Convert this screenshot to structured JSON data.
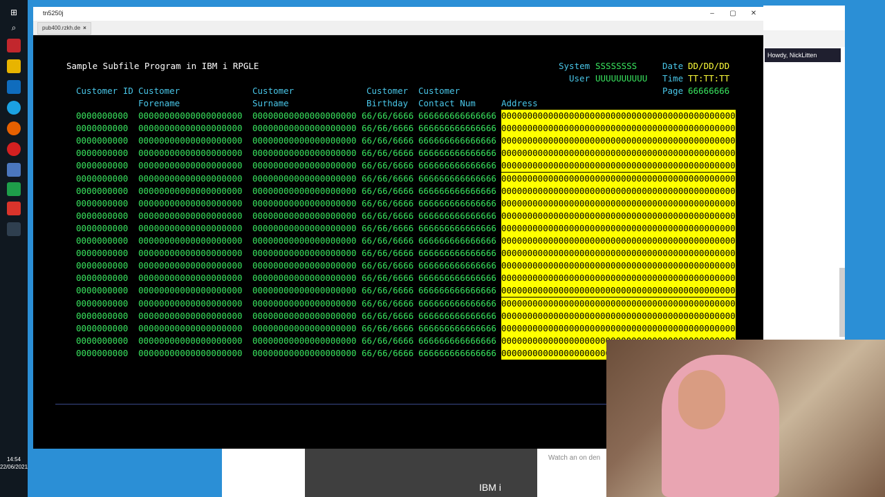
{
  "window": {
    "title": "tn5250j",
    "tab": "pub400.rzkh.de",
    "tab_close": "×",
    "minimize": "–",
    "maximize": "▢",
    "close": "✕"
  },
  "screen": {
    "title": "Sample Subfile Program in IBM i RPGLE",
    "system_label": "System",
    "system_value": "SSSSSSSS",
    "user_label": "User",
    "user_value": "UUUUUUUUUU",
    "date_label": "Date",
    "date_value": "DD/DD/DD",
    "time_label": "Time",
    "time_value": "TT:TT:TT",
    "page_label": "Page",
    "page_value": "66666666",
    "headers": {
      "customer_id": "Customer ID",
      "customer": "Customer",
      "forename": "Forename",
      "surname": "Surname",
      "birthday": "Birthday",
      "contact_num": "Contact Num",
      "address": "Address"
    },
    "rows": [
      {
        "id": "0000000000",
        "forename": "00000000000000000000",
        "surname": "00000000000000000000",
        "birthday": "66/66/6666",
        "contact": "666666666666666",
        "address": "000000000000000000000000000000000000000000000"
      },
      {
        "id": "0000000000",
        "forename": "00000000000000000000",
        "surname": "00000000000000000000",
        "birthday": "66/66/6666",
        "contact": "666666666666666",
        "address": "000000000000000000000000000000000000000000000"
      },
      {
        "id": "0000000000",
        "forename": "00000000000000000000",
        "surname": "00000000000000000000",
        "birthday": "66/66/6666",
        "contact": "666666666666666",
        "address": "000000000000000000000000000000000000000000000"
      },
      {
        "id": "0000000000",
        "forename": "00000000000000000000",
        "surname": "00000000000000000000",
        "birthday": "66/66/6666",
        "contact": "666666666666666",
        "address": "000000000000000000000000000000000000000000000"
      },
      {
        "id": "0000000000",
        "forename": "00000000000000000000",
        "surname": "00000000000000000000",
        "birthday": "66/66/6666",
        "contact": "666666666666666",
        "address": "000000000000000000000000000000000000000000000"
      },
      {
        "id": "0000000000",
        "forename": "00000000000000000000",
        "surname": "00000000000000000000",
        "birthday": "66/66/6666",
        "contact": "666666666666666",
        "address": "000000000000000000000000000000000000000000000"
      },
      {
        "id": "0000000000",
        "forename": "00000000000000000000",
        "surname": "00000000000000000000",
        "birthday": "66/66/6666",
        "contact": "666666666666666",
        "address": "000000000000000000000000000000000000000000000"
      },
      {
        "id": "0000000000",
        "forename": "00000000000000000000",
        "surname": "00000000000000000000",
        "birthday": "66/66/6666",
        "contact": "666666666666666",
        "address": "000000000000000000000000000000000000000000000"
      },
      {
        "id": "0000000000",
        "forename": "00000000000000000000",
        "surname": "00000000000000000000",
        "birthday": "66/66/6666",
        "contact": "666666666666666",
        "address": "000000000000000000000000000000000000000000000"
      },
      {
        "id": "0000000000",
        "forename": "00000000000000000000",
        "surname": "00000000000000000000",
        "birthday": "66/66/6666",
        "contact": "666666666666666",
        "address": "000000000000000000000000000000000000000000000"
      },
      {
        "id": "0000000000",
        "forename": "00000000000000000000",
        "surname": "00000000000000000000",
        "birthday": "66/66/6666",
        "contact": "666666666666666",
        "address": "000000000000000000000000000000000000000000000"
      },
      {
        "id": "0000000000",
        "forename": "00000000000000000000",
        "surname": "00000000000000000000",
        "birthday": "66/66/6666",
        "contact": "666666666666666",
        "address": "000000000000000000000000000000000000000000000"
      },
      {
        "id": "0000000000",
        "forename": "00000000000000000000",
        "surname": "00000000000000000000",
        "birthday": "66/66/6666",
        "contact": "666666666666666",
        "address": "000000000000000000000000000000000000000000000"
      },
      {
        "id": "0000000000",
        "forename": "00000000000000000000",
        "surname": "00000000000000000000",
        "birthday": "66/66/6666",
        "contact": "666666666666666",
        "address": "000000000000000000000000000000000000000000000"
      },
      {
        "id": "0000000000",
        "forename": "00000000000000000000",
        "surname": "00000000000000000000",
        "birthday": "66/66/6666",
        "contact": "666666666666666",
        "address": "000000000000000000000000000000000000000000000"
      },
      {
        "id": "0000000000",
        "forename": "00000000000000000000",
        "surname": "00000000000000000000",
        "birthday": "66/66/6666",
        "contact": "666666666666666",
        "address": "000000000000000000000000000000000000000000000"
      },
      {
        "id": "0000000000",
        "forename": "00000000000000000000",
        "surname": "00000000000000000000",
        "birthday": "66/66/6666",
        "contact": "666666666666666",
        "address": "000000000000000000000000000000000000000000000"
      },
      {
        "id": "0000000000",
        "forename": "00000000000000000000",
        "surname": "00000000000000000000",
        "birthday": "66/66/6666",
        "contact": "666666666666666",
        "address": "000000000000000000000000000000000000000000000"
      },
      {
        "id": "0000000000",
        "forename": "00000000000000000000",
        "surname": "00000000000000000000",
        "birthday": "66/66/6666",
        "contact": "666666666666666",
        "address": "000000000000000000000000000000000000000000000"
      },
      {
        "id": "0000000000",
        "forename": "00000000000000000000",
        "surname": "00000000000000000000",
        "birthday": "66/66/6666",
        "contact": "666666666666666",
        "address": "000000000000000000000000000000000000000000000"
      }
    ]
  },
  "background": {
    "browser_user": "Howdy, NickLitten",
    "web_title": "IBM i",
    "web_watch": "Watch an on den"
  },
  "taskbar": {
    "time": "14:54",
    "date": "22/06/2021"
  },
  "colors": {
    "screen_bg": "#000000",
    "text_green": "#39e55f",
    "text_turquoise": "#49c6e8",
    "text_yellow": "#ffff3a",
    "address_highlight": "#ffff00"
  }
}
